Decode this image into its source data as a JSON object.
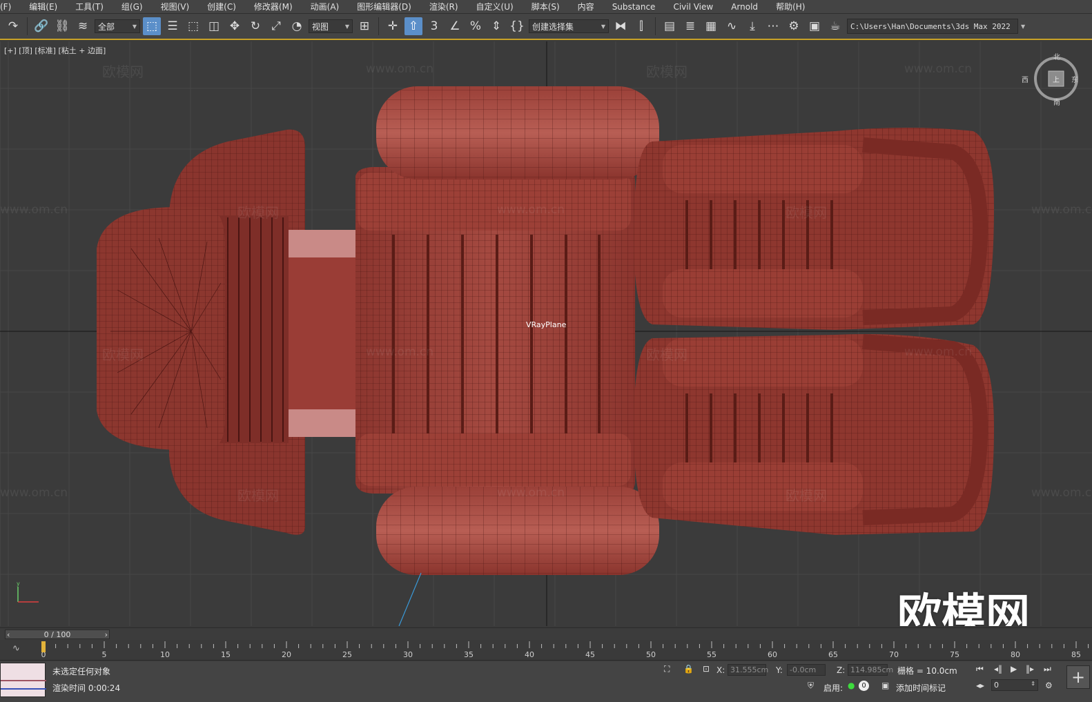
{
  "menu": {
    "items": [
      "(F)",
      "编辑(E)",
      "工具(T)",
      "组(G)",
      "视图(V)",
      "创建(C)",
      "修改器(M)",
      "动画(A)",
      "图形编辑器(D)",
      "渲染(R)",
      "自定义(U)",
      "脚本(S)",
      "内容",
      "Substance",
      "Civil View",
      "Arnold",
      "帮助(H)"
    ]
  },
  "toolbar": {
    "selection_filter": "全部",
    "ref_coord": "视图",
    "named_selection": "创建选择集",
    "project_path": "C:\\Users\\Han\\Documents\\3ds Max 2022",
    "snap_label": "3"
  },
  "viewport": {
    "label": "[+] [顶] [标准] [粘土 + 边面]",
    "object_name": "VRayPlane",
    "watermark_text": "欧模网",
    "watermark_url": "www.om.cn",
    "watermark_big": "欧模网",
    "viewcube": {
      "north": "北",
      "south": "南",
      "west": "西",
      "east": "东",
      "face": "上"
    },
    "colors": {
      "model": "#8f3a32",
      "model_light": "#b05a50",
      "wire": "#4a1512",
      "grid": "#4a4a4a",
      "background": "#3b3b3b"
    }
  },
  "timeline": {
    "current": "0 / 100",
    "frame": 0,
    "total": 100,
    "ticks": [
      "0",
      "5",
      "10",
      "15",
      "20",
      "25",
      "30",
      "35",
      "40",
      "45",
      "50",
      "55",
      "60",
      "65",
      "70",
      "75",
      "80",
      "85"
    ]
  },
  "status": {
    "prompt": "未选定任何对象",
    "render_time": "渲染时间  0:00:24",
    "x_label": "X:",
    "x_value": "31.555cm",
    "y_label": "Y:",
    "y_value": "-0.0cm",
    "z_label": "Z:",
    "z_value": "114.985cm",
    "grid": "栅格 = 10.0cm",
    "enable": "启用:",
    "enable_count": "0",
    "add_time_tag": "添加时间标记",
    "frame_value": "0"
  }
}
